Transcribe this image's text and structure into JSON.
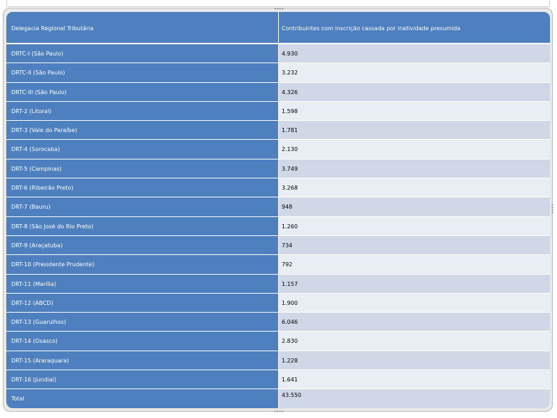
{
  "table": {
    "headers": [
      "Delegacia Regional Tributária",
      "Contribuintes com inscrição cassada por inatividade presumida"
    ],
    "rows": [
      {
        "name": "DRTC-I (São Paulo)",
        "value": "4.930"
      },
      {
        "name": "DRTC-II (São Paulo)",
        "value": "3.232"
      },
      {
        "name": "DRTC-III (São Paulo)",
        "value": "4.326"
      },
      {
        "name": "DRT-2 (Litoral)",
        "value": "1.598"
      },
      {
        "name": "DRT-3 (Vale do Paraíbe)",
        "value": "1.781"
      },
      {
        "name": "DRT-4 (Sorocaba)",
        "value": "2.130"
      },
      {
        "name": "DRT-5 (Campinas)",
        "value": "3.749"
      },
      {
        "name": "DRT-6 (Ribeirão Preto)",
        "value": "3.268"
      },
      {
        "name": "DRT-7 (Bauru)",
        "value": "948"
      },
      {
        "name": "DRT-8 (São José do Rio Preto)",
        "value": "1.260"
      },
      {
        "name": "DRT-9 (Araçatuba)",
        "value": "734"
      },
      {
        "name": "DRT-10 (Presidente Prudente)",
        "value": "792"
      },
      {
        "name": "DRT-11 (Marília)",
        "value": "1.157"
      },
      {
        "name": "DRT-12 (ABCD)",
        "value": "1.900"
      },
      {
        "name": "DRT-13 (Guarulhos)",
        "value": "6.046"
      },
      {
        "name": "DRT-14 (Osasco)",
        "value": "2.830"
      },
      {
        "name": "DRT-15 (Araraquara)",
        "value": "1.228"
      },
      {
        "name": "DRT-16 (Jundiaí)",
        "value": "1.641"
      },
      {
        "name": "Total",
        "value": "43.550"
      }
    ]
  }
}
